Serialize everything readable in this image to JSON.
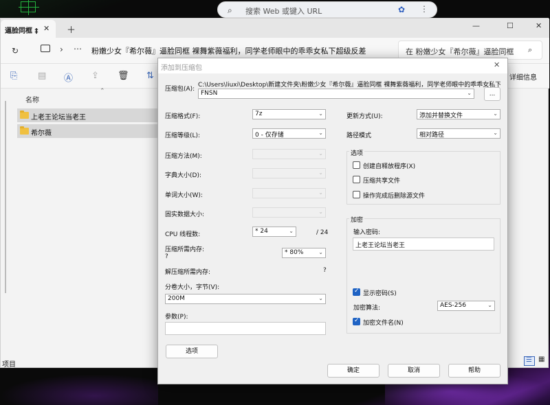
{
  "browser": {
    "search_placeholder": "搜索 Web 或键入 URL"
  },
  "explorer": {
    "tab_title": "逼脸同框 ‡",
    "address_path": "粉嫩少女『希尔薇』逼脸同框 裸舞紫薇福利，同学老师眼中的乖乖女私下超级反差",
    "search_box": "在 粉嫩少女『希尔薇』逼脸同框",
    "details_label": "详细信息",
    "column_name": "名称",
    "files": [
      "上老王论坛当老王",
      "希尔薇"
    ],
    "status_text": "项目"
  },
  "dialog": {
    "title": "添加到压缩包",
    "archive_label": "压缩包(A):",
    "archive_path": "C:\\Users\\liuxi\\Desktop\\新建文件夹\\粉嫩少女『希尔薇』逼脸同框 裸舞紫薇福利，同学老师眼中的乖乖女私下超级反",
    "archive_name": "FNSN",
    "browse_label": "...",
    "format_label": "压缩格式(F):",
    "format_value": "7z",
    "level_label": "压缩等级(L):",
    "level_value": "0 - 仅存储",
    "method_label": "压缩方法(M):",
    "dict_label": "字典大小(D):",
    "word_label": "单词大小(W):",
    "solid_label": "固实数据大小:",
    "cpu_label": "CPU 线程数:",
    "cpu_value": "* 24",
    "cpu_total": "/ 24",
    "mem_label": "压缩所需内存:",
    "mem_q": "?",
    "mem_value": "* 80%",
    "demem_label": "解压缩所需内存:",
    "demem_value": "?",
    "split_label": "分卷大小，字节(V):",
    "split_value": "200M",
    "params_label": "参数(P):",
    "options_button": "选项",
    "update_label": "更新方式(U):",
    "update_value": "添加并替换文件",
    "pathmode_label": "路径模式",
    "pathmode_value": "相对路径",
    "options_group": "选项",
    "opt_sfx": "创建自释放程序(X)",
    "opt_shared": "压缩共享文件",
    "opt_delete": "操作完成后删除源文件",
    "encrypt_group": "加密",
    "password_label": "输入密码:",
    "password_value": "上老王论坛当老王",
    "show_password": "显示密码(S)",
    "enc_method_label": "加密算法:",
    "enc_method_value": "AES-256",
    "enc_names": "加密文件名(N)",
    "ok_button": "确定",
    "cancel_button": "取消",
    "help_button": "帮助"
  }
}
